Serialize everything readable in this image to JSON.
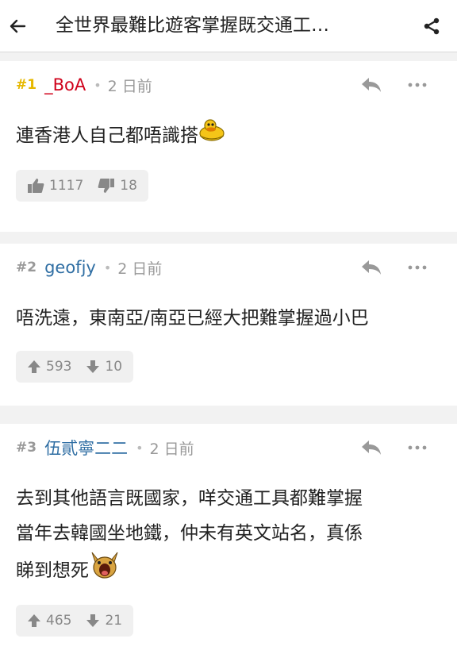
{
  "header": {
    "title": "全世界最難比遊客掌握既交通工…"
  },
  "posts": [
    {
      "floor": "#1",
      "username": "_BoA",
      "separator": "•",
      "time": "2 日前",
      "content": "連香港人自己都唔識搭",
      "sticker": "duck-emoji",
      "vote_style": "thumbs",
      "up": "1117",
      "down": "18"
    },
    {
      "floor": "#2",
      "username": "geofjy",
      "separator": "•",
      "time": "2 日前",
      "content": "唔洗遠，東南亞/南亞已經大把難掌握過小巴",
      "vote_style": "arrows",
      "up": "593",
      "down": "10"
    },
    {
      "floor": "#3",
      "username": "伍貳寧二二",
      "separator": "•",
      "time": "2 日前",
      "content_lines": [
        "去到其他語言既國家，咩交通工具都難掌握",
        "當年去韓國坐地鐵，仲未有英文站名，真係",
        "睇到想死"
      ],
      "sticker": "screaming-emoji",
      "vote_style": "arrows",
      "up": "465",
      "down": "21"
    }
  ],
  "colors": {
    "floor_gold": "#e6b800",
    "username_red": "#d0021b",
    "username_blue": "#2f6ea3",
    "meta_gray": "#999999",
    "divider_bg": "#f2f2f2"
  }
}
